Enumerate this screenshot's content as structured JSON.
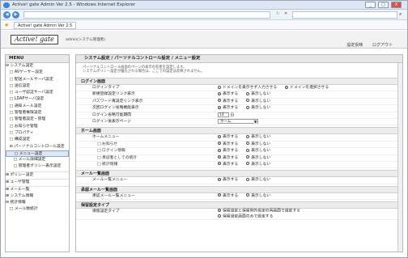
{
  "window": {
    "title": "Active! gate Admin Ver 2.5 - Windows Internet Explorer",
    "tab": "Active! gate Admin Ver 2.5",
    "min": "_",
    "max": "□",
    "close": "X"
  },
  "app": {
    "logo": "Active! gate",
    "user": "admin(システム管理者)",
    "links": [
      "設定反映",
      "ログアウト"
    ]
  },
  "sidebar": {
    "header": "MENU",
    "items": [
      {
        "label": "⊟ システム設定",
        "sec": false,
        "sel": false
      },
      {
        "label": "　□ AVゲーサー設定",
        "sec": false,
        "sel": false
      },
      {
        "label": "　□ 配送メールサーバ設定",
        "sec": false,
        "sel": false
      },
      {
        "label": "　□ 送信設定",
        "sec": false,
        "sel": false
      },
      {
        "label": "　□ ユーザ認証サーバ設定",
        "sec": false,
        "sel": false
      },
      {
        "label": "　□ LDAPサーバ設定",
        "sec": false,
        "sel": false
      },
      {
        "label": "　□ 通知メール設定",
        "sec": false,
        "sel": false
      },
      {
        "label": "　□ 管理者権限設定",
        "sec": false,
        "sel": false
      },
      {
        "label": "　□ 管理者設定・管理",
        "sec": false,
        "sel": false
      },
      {
        "label": "　□ お知らせ管理",
        "sec": false,
        "sel": false
      },
      {
        "label": "　□ プロパティ",
        "sec": false,
        "sel": false
      },
      {
        "label": "　□ 構成設定",
        "sec": false,
        "sel": false
      },
      {
        "label": "　⊟ パーソナルコントロール設定",
        "sec": false,
        "sel": false
      },
      {
        "label": "　　□ メニュー設定",
        "sec": false,
        "sel": true
      },
      {
        "label": "　　□ メール詳細設定",
        "sec": false,
        "sel": false
      },
      {
        "label": "　　□ 管理者ポリシー表示設定",
        "sec": false,
        "sel": false
      },
      {
        "label": "⊞ ポリシー設定",
        "sec": true,
        "sel": false
      },
      {
        "label": "⊞ ユーザ管理",
        "sec": true,
        "sel": false
      },
      {
        "label": "⊞ メール一覧",
        "sec": true,
        "sel": false
      },
      {
        "label": "⊞ システム情報",
        "sec": false,
        "sel": false
      },
      {
        "label": "⊟ 統計情報",
        "sec": false,
        "sel": false
      },
      {
        "label": "　□ メール数統計",
        "sec": false,
        "sel": false
      }
    ]
  },
  "main": {
    "breadcrumb": "システム設定 / パーソナルコントロール設定 / メニュー設定",
    "description": [
      "パーソナルコントロール画面のページの表示の有無を設定します。",
      "システムポリシー設定が優先される場合は、ここでの設定は反映されません。"
    ],
    "sections": [
      {
        "title": "ログイン画面",
        "rows": [
          {
            "label": "ログインタイプ",
            "type": "radio",
            "options": [
              "ドメインを表示せず入力させる",
              "ドメインを選択させる"
            ],
            "checked": 1
          },
          {
            "label": "新規登録設定リンク表示",
            "type": "radio",
            "options": [
              "表示する",
              "表示しない"
            ],
            "checked": 0
          },
          {
            "label": "パスワード再設定リンク表示",
            "type": "radio",
            "options": [
              "表示する",
              "表示しない"
            ],
            "checked": 0
          },
          {
            "label": "次回ログイン省略機能表示",
            "type": "radio",
            "options": [
              "表示する",
              "表示しない"
            ],
            "checked": 0
          },
          {
            "label": "ログイン省略可能期間",
            "type": "number",
            "value": "14",
            "unit": "日"
          },
          {
            "label": "ログイン後表示ページ",
            "type": "select",
            "value": "ホーム"
          }
        ]
      },
      {
        "title": "ホーム画面",
        "rows": [
          {
            "label": "ホームメニュー",
            "type": "radio",
            "options": [
              "表示する",
              "表示しない"
            ],
            "checked": 0
          },
          {
            "label": "□ お知らせ",
            "sub": true,
            "type": "radio",
            "options": [
              "表示する",
              "表示しない"
            ],
            "checked": 0
          },
          {
            "label": "□ ログイン情報",
            "sub": true,
            "type": "radio",
            "options": [
              "表示する",
              "表示しない"
            ],
            "checked": 0
          },
          {
            "label": "□ 承認者としての統計",
            "sub": true,
            "type": "radio",
            "options": [
              "表示する",
              "表示しない"
            ],
            "checked": 0
          },
          {
            "label": "□ 統計情報",
            "sub": true,
            "type": "radio",
            "options": [
              "表示する",
              "表示しない"
            ],
            "checked": 0
          }
        ]
      },
      {
        "title": "メール一覧画面",
        "rows": [
          {
            "label": "メール一覧メニュー",
            "type": "radio",
            "options": [
              "表示する",
              "表示しない"
            ],
            "checked": 0
          }
        ]
      },
      {
        "title": "承認メール一覧画面",
        "rows": [
          {
            "label": "承認メール一覧メニュー",
            "type": "radio",
            "options": [
              "表示する",
              "表示しない"
            ],
            "checked": 0
          }
        ]
      },
      {
        "title": "保留設定タイプ",
        "rows": [
          {
            "label": "保留設定タイプ",
            "type": "radio2",
            "options": [
              "保留設定と保留例外設定の両画面で設定する",
              "保留設定画面のみで設定する"
            ],
            "checked": 0
          }
        ]
      }
    ]
  }
}
